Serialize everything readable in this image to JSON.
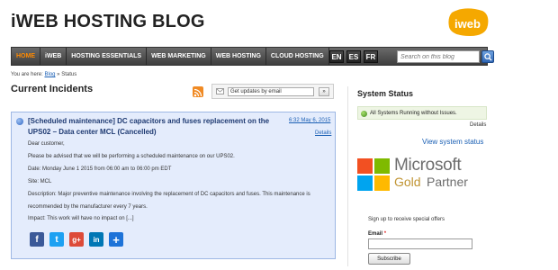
{
  "site": {
    "title": "iWEB HOSTING BLOG",
    "logo_text": "iweb",
    "logo_color": "#f5a800"
  },
  "nav": {
    "items": [
      {
        "label": "HOME",
        "active": true
      },
      {
        "label": "iWEB"
      },
      {
        "label": "HOSTING ESSENTIALS"
      },
      {
        "label": "WEB MARKETING"
      },
      {
        "label": "WEB HOSTING"
      },
      {
        "label": "CLOUD HOSTING"
      }
    ],
    "languages": [
      "EN",
      "ES",
      "FR"
    ],
    "search_placeholder": "Search on this blog",
    "active_color": "#ff8a00"
  },
  "breadcrumb": {
    "prefix": "You are here:",
    "link": "Blog",
    "separator": "»",
    "current": "Status"
  },
  "page_title": "Current Incidents",
  "updates": {
    "input_value": "Get updates by email",
    "button": "»"
  },
  "incident": {
    "title": "[Scheduled maintenance] DC capacitors and fuses replacement on the UPS02 – Data center MCL (Cancelled)",
    "date": "6:32 May 6, 2015",
    "details_link": "Details",
    "body": [
      "Dear customer,",
      "Please be advised that we will be performing a scheduled maintenance on our UPS02.",
      "Date: Monday June 1 2015 from 06:00 am to 06:00 pm EDT",
      "Site: MCL",
      "Description: Major preventive maintenance involving the replacement of DC capacitors and fuses. This maintenance is",
      "recommended by the manufacturer every 7 years.",
      "Impact: This work will have no impact on [...]"
    ],
    "share": [
      {
        "icon": "facebook-icon",
        "glyph": "f",
        "color": "#3b5998"
      },
      {
        "icon": "twitter-icon",
        "glyph": "t",
        "color": "#1da1f2"
      },
      {
        "icon": "google-plus-icon",
        "glyph": "g+",
        "color": "#dd4b39"
      },
      {
        "icon": "linkedin-icon",
        "glyph": "in",
        "color": "#0077b5"
      },
      {
        "icon": "share-plus-icon",
        "glyph": "+",
        "color": "#1e73d8"
      }
    ]
  },
  "system_status": {
    "heading": "System Status",
    "status_text": "All Systems Running without Issues.",
    "details": "Details",
    "view_link": "View system status",
    "status_color": "#3f8a1d"
  },
  "partner": {
    "word": "Microsoft",
    "tier": "Gold",
    "suffix": "Partner"
  },
  "newsletter": {
    "intro": "Sign up to receive special offers",
    "email_label": "Email",
    "required_mark": "*",
    "button": "Subscribe"
  }
}
